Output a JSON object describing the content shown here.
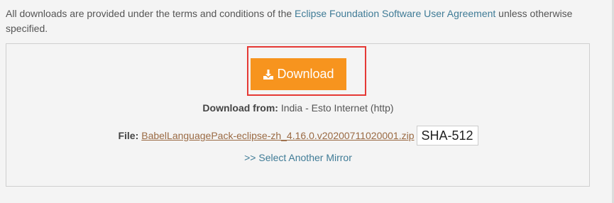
{
  "notice": {
    "text_before": "All downloads are provided under the terms and conditions of the ",
    "link": "Eclipse Foundation Software User Agreement",
    "text_after": " unless otherwise specified."
  },
  "download_button": {
    "label": "Download"
  },
  "download_from": {
    "label": "Download from:",
    "value": " India - Esto Internet (http)"
  },
  "file": {
    "label": "File:",
    "filename": "BabelLanguagePack-eclipse-zh_4.16.0.v20200711020001.zip",
    "checksum_label": "SHA-512"
  },
  "mirror_link": ">> Select Another Mirror",
  "colors": {
    "download_button": "#f7941e",
    "highlight_border": "#e53935",
    "link": "#3f7b96",
    "file_link": "#9a6a43"
  }
}
